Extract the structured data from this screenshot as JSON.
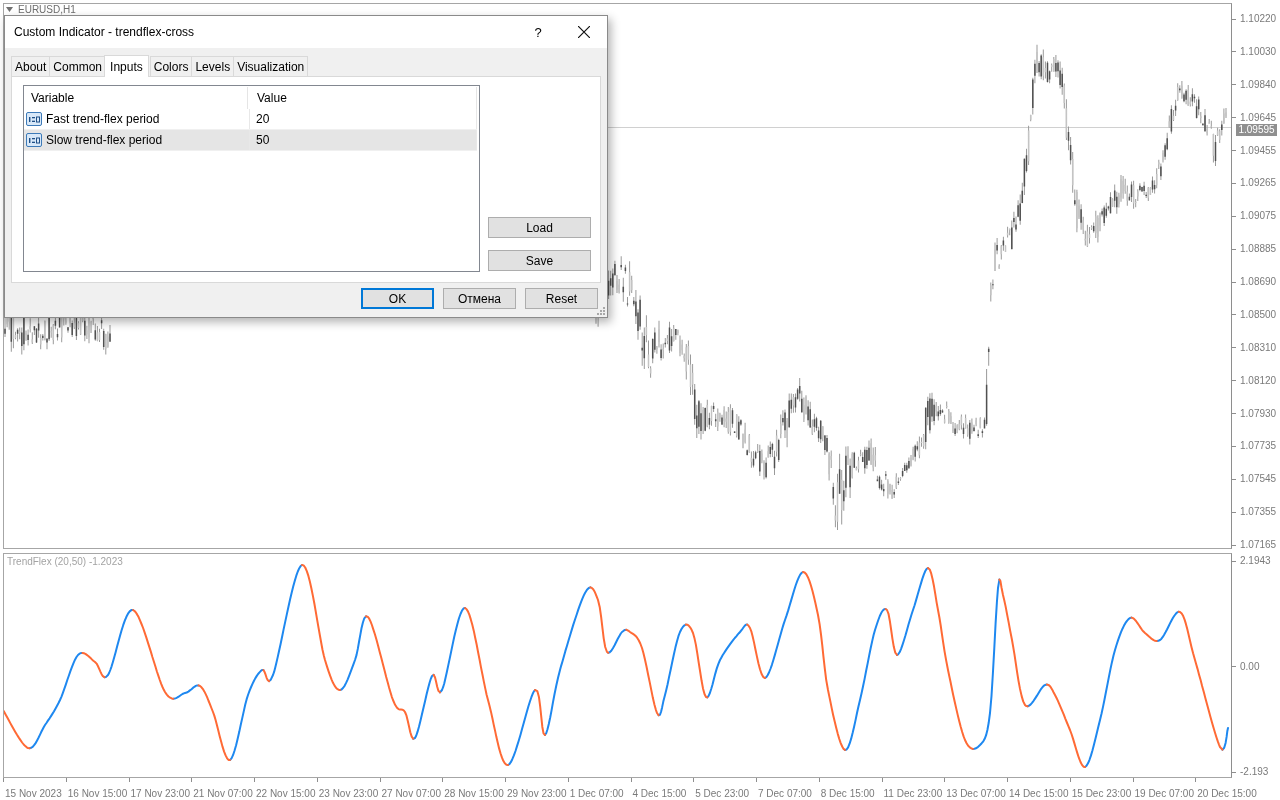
{
  "chart_window": {
    "symbol": "EURUSD,H1"
  },
  "price_axis": {
    "labels": [
      "1.10220",
      "1.10030",
      "1.09840",
      "1.09645",
      "1.09455",
      "1.09265",
      "1.09075",
      "1.08885",
      "1.08690",
      "1.08500",
      "1.08310",
      "1.08120",
      "1.07930",
      "1.07735",
      "1.07545",
      "1.07355",
      "1.07165"
    ],
    "current_price": "1.09595"
  },
  "indicator": {
    "label": "TrendFlex (20,50) -1.2023",
    "axis_labels": [
      "2.1943",
      "0.00",
      "-2.193"
    ]
  },
  "time_axis": {
    "labels": [
      "15 Nov 2023",
      "16 Nov 15:00",
      "17 Nov 23:00",
      "21 Nov 07:00",
      "22 Nov 15:00",
      "23 Nov 23:00",
      "27 Nov 07:00",
      "28 Nov 15:00",
      "29 Nov 23:00",
      "1 Dec 07:00",
      "4 Dec 15:00",
      "5 Dec 23:00",
      "7 Dec 07:00",
      "8 Dec 15:00",
      "11 Dec 23:00",
      "13 Dec 07:00",
      "14 Dec 15:00",
      "15 Dec 23:00",
      "19 Dec 07:00",
      "20 Dec 15:00"
    ]
  },
  "dialog": {
    "title": "Custom Indicator - trendflex-cross",
    "help": "?",
    "tabs": [
      {
        "label": "About",
        "selected": false
      },
      {
        "label": "Common",
        "selected": false
      },
      {
        "label": "Inputs",
        "selected": true
      },
      {
        "label": "Colors",
        "selected": false
      },
      {
        "label": "Levels",
        "selected": false
      },
      {
        "label": "Visualization",
        "selected": false
      }
    ],
    "table": {
      "columns": [
        "Variable",
        "Value"
      ],
      "rows": [
        {
          "variable": "Fast trend-flex period",
          "value": "20",
          "selected": false
        },
        {
          "variable": "Slow trend-flex period",
          "value": "50",
          "selected": true
        }
      ]
    },
    "side_buttons": [
      "Load",
      "Save"
    ],
    "buttons": [
      {
        "label": "OK",
        "default": true
      },
      {
        "label": "Отмена",
        "default": false
      },
      {
        "label": "Reset",
        "default": false
      }
    ]
  }
}
